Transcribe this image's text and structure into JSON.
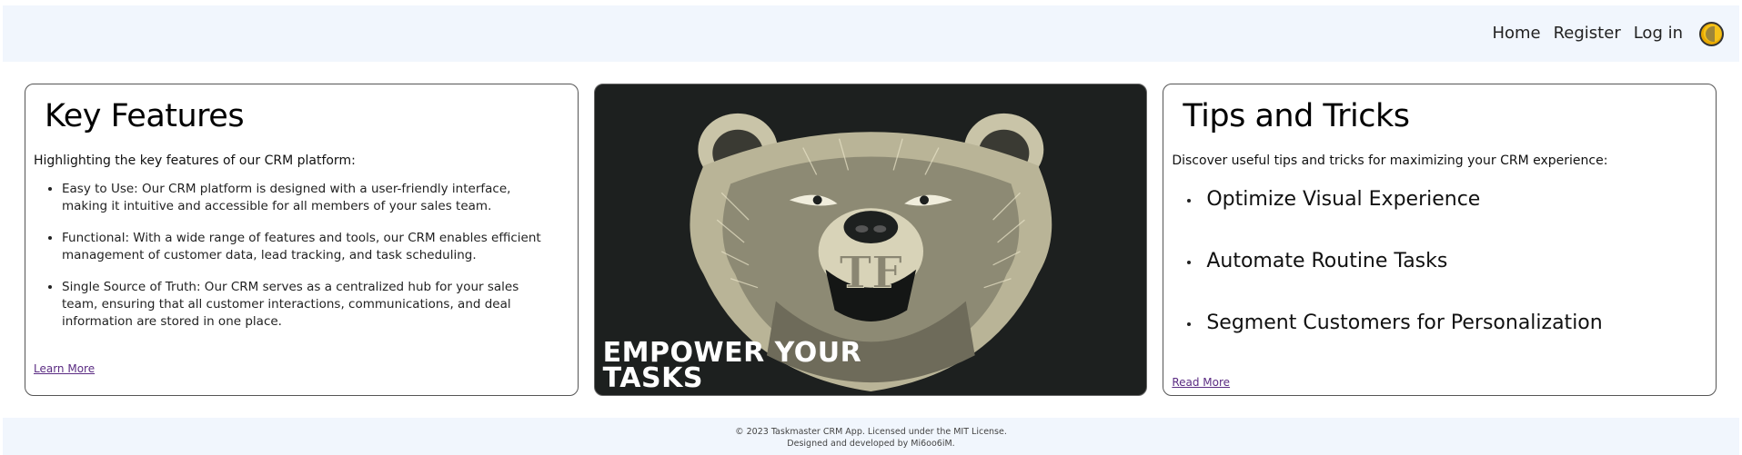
{
  "nav": {
    "links": [
      "Home",
      "Register",
      "Log in"
    ],
    "theme_toggle_icon": "theme-toggle-icon"
  },
  "features_card": {
    "title": "Key Features",
    "intro": "Highlighting the key features of our CRM platform:",
    "items": [
      "Easy to Use: Our CRM platform is designed with a user-friendly interface, making it intuitive and accessible for all members of your sales team.",
      "Functional: With a wide range of features and tools, our CRM enables efficient management of customer data, lead tracking, and task scheduling.",
      "Single Source of Truth: Our CRM serves as a centralized hub for your sales team, ensuring that all customer interactions, communications, and deal information are stored in one place."
    ],
    "link": "Learn More"
  },
  "hero": {
    "monogram": "TF",
    "tagline": "EMPOWER YOUR\nTASKS",
    "image_icon": "bear-illustration"
  },
  "tips_card": {
    "title": "Tips and Tricks",
    "intro": "Discover useful tips and tricks for maximizing your CRM experience:",
    "items": [
      "Optimize Visual Experience",
      "Automate Routine Tasks",
      "Segment Customers for Personalization"
    ],
    "link": "Read More"
  },
  "footer": {
    "line1": "© 2023 Taskmaster CRM App. Licensed under the MIT License.",
    "line2": "Designed and developed by Mi6oo6iM."
  },
  "colors": {
    "bar_background": "#f1f6fd",
    "hero_background": "#1d201f",
    "link": "#5b2c83",
    "toggle_accent": "#f5c218"
  }
}
